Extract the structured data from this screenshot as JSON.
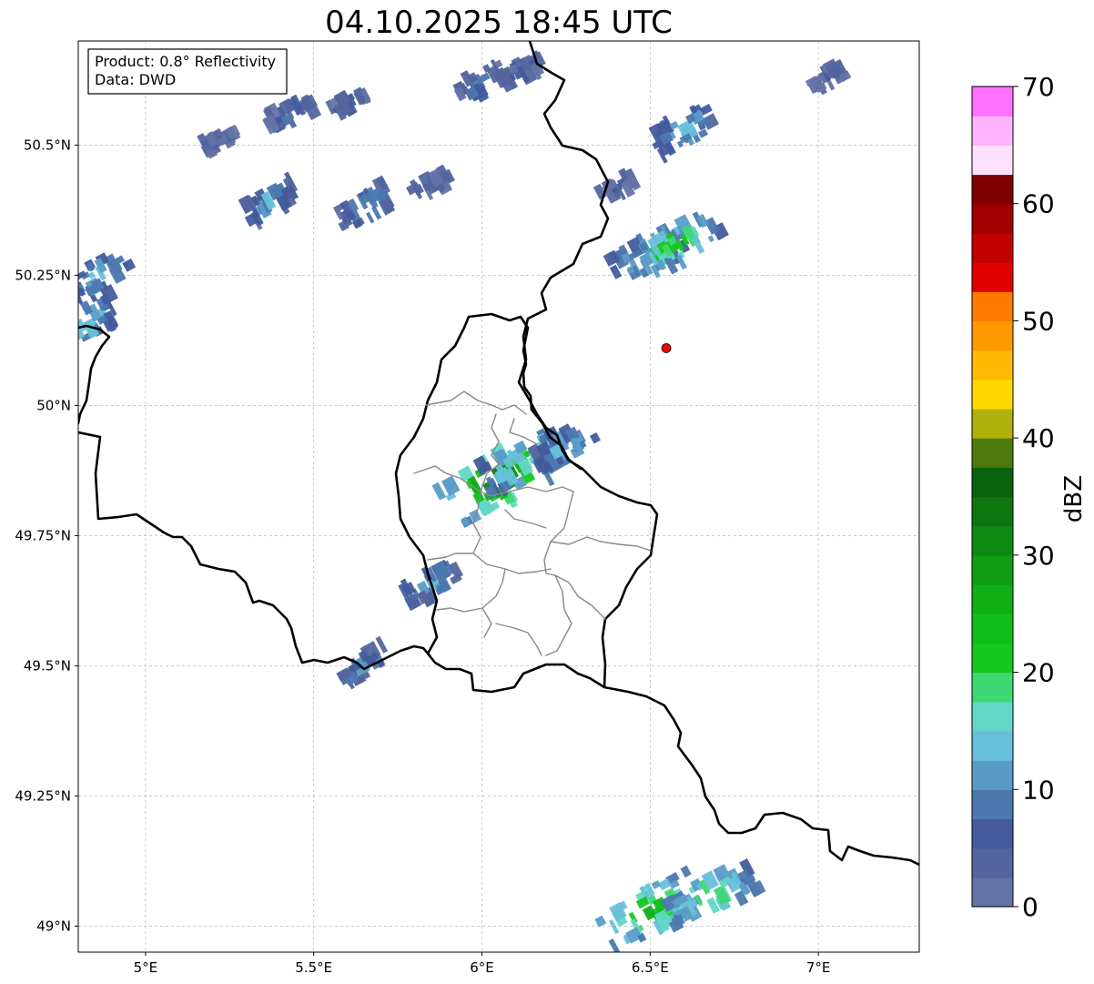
{
  "title": "04.10.2025 18:45 UTC",
  "info": {
    "product": "Product: 0.8° Reflectivity",
    "data": "Data: DWD"
  },
  "map": {
    "lon_range": [
      4.8,
      7.3
    ],
    "lat_range": [
      48.95,
      50.7
    ],
    "lon_ticks": [
      {
        "value": 5.0,
        "label": "5°E"
      },
      {
        "value": 5.5,
        "label": "5.5°E"
      },
      {
        "value": 6.0,
        "label": "6°E"
      },
      {
        "value": 6.5,
        "label": "6.5°E"
      },
      {
        "value": 7.0,
        "label": "7°E"
      }
    ],
    "lat_ticks": [
      {
        "value": 50.5,
        "label": "50.5°N"
      },
      {
        "value": 50.25,
        "label": "50.25°N"
      },
      {
        "value": 50.0,
        "label": "50°N"
      },
      {
        "value": 49.75,
        "label": "49.75°N"
      },
      {
        "value": 49.5,
        "label": "49.5°N"
      },
      {
        "value": 49.25,
        "label": "49.25°N"
      },
      {
        "value": 49.0,
        "label": "49°N"
      }
    ],
    "gridlines": true,
    "radar_site": {
      "lon": 6.548,
      "lat": 50.11,
      "color": "#ff0000"
    }
  },
  "colorbar": {
    "label": "dBZ",
    "min": 0,
    "max": 70,
    "step": 2.5,
    "tick_values": [
      0,
      10,
      20,
      30,
      40,
      50,
      60,
      70
    ],
    "colors": [
      "#6473a6",
      "#53659e",
      "#435b9d",
      "#4b78af",
      "#5a9cc7",
      "#67c0da",
      "#62d7c5",
      "#3ed873",
      "#14c81e",
      "#11bd1b",
      "#10af16",
      "#0f9e13",
      "#0d8a11",
      "#0c770f",
      "#0a620d",
      "#4c7a0c",
      "#afb10b",
      "#ffd900",
      "#ffb900",
      "#ff9a00",
      "#ff7b00",
      "#e10000",
      "#c10000",
      "#a20000",
      "#7e0000",
      "#ffe1ff",
      "#ffb4ff",
      "#ff70ff",
      "#ee33ee"
    ]
  },
  "echoes": [
    {
      "lon": 5.43,
      "lat": 50.56,
      "intensity": 8
    },
    {
      "lon": 5.6,
      "lat": 50.58,
      "intensity": 6
    },
    {
      "lon": 5.22,
      "lat": 50.51,
      "intensity": 5
    },
    {
      "lon": 6.0,
      "lat": 50.62,
      "intensity": 10
    },
    {
      "lon": 6.12,
      "lat": 50.64,
      "intensity": 7
    },
    {
      "lon": 5.37,
      "lat": 50.39,
      "intensity": 12
    },
    {
      "lon": 5.65,
      "lat": 50.38,
      "intensity": 12
    },
    {
      "lon": 5.85,
      "lat": 50.42,
      "intensity": 5
    },
    {
      "lon": 6.5,
      "lat": 50.29,
      "intensity": 18
    },
    {
      "lon": 6.58,
      "lat": 50.31,
      "intensity": 22
    },
    {
      "lon": 6.6,
      "lat": 50.53,
      "intensity": 14
    },
    {
      "lon": 6.4,
      "lat": 50.42,
      "intensity": 5
    },
    {
      "lon": 7.03,
      "lat": 50.63,
      "intensity": 5
    },
    {
      "lon": 4.86,
      "lat": 50.25,
      "intensity": 14
    },
    {
      "lon": 4.82,
      "lat": 50.16,
      "intensity": 16
    },
    {
      "lon": 6.05,
      "lat": 49.86,
      "intensity": 32
    },
    {
      "lon": 6.12,
      "lat": 49.89,
      "intensity": 20
    },
    {
      "lon": 6.25,
      "lat": 49.92,
      "intensity": 14
    },
    {
      "lon": 5.85,
      "lat": 49.66,
      "intensity": 12
    },
    {
      "lon": 5.65,
      "lat": 49.5,
      "intensity": 10
    },
    {
      "lon": 6.5,
      "lat": 49.03,
      "intensity": 26
    },
    {
      "lon": 6.68,
      "lat": 49.06,
      "intensity": 22
    }
  ]
}
